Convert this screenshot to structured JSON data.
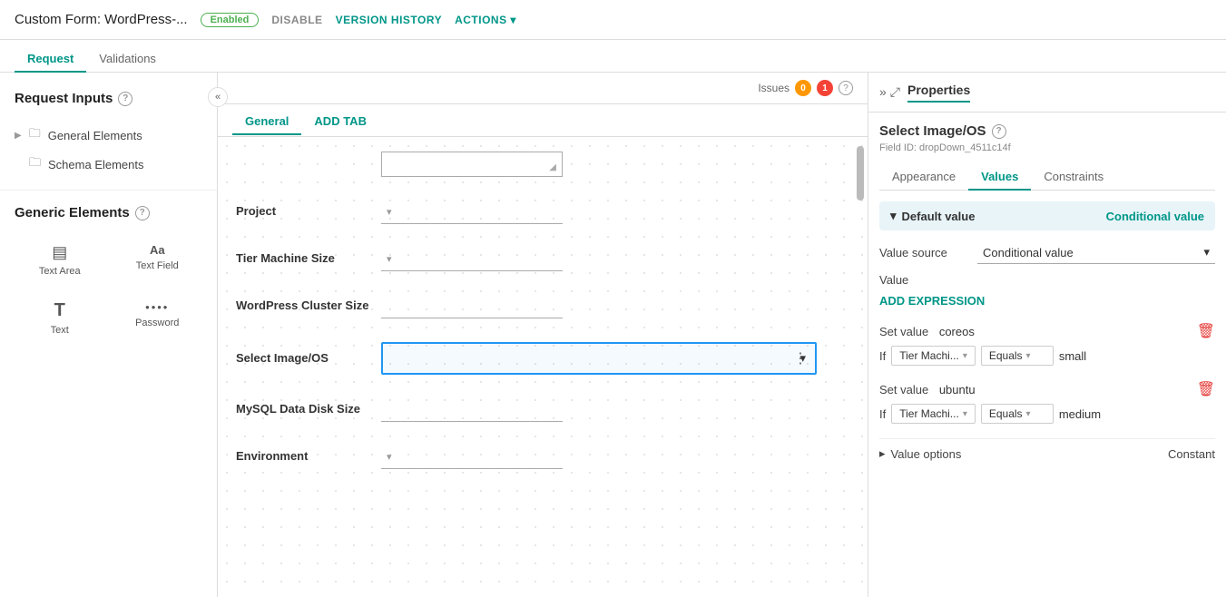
{
  "topbar": {
    "title": "Custom Form: WordPress-...",
    "status": "Enabled",
    "disable_btn": "DISABLE",
    "version_history_btn": "VERSION HISTORY",
    "actions_btn": "ACTIONS ▾"
  },
  "main_tabs": [
    {
      "label": "Request",
      "active": true
    },
    {
      "label": "Validations",
      "active": false
    }
  ],
  "left_sidebar": {
    "collapse_icon": "«",
    "request_inputs_title": "Request Inputs",
    "help_icon": "?",
    "groups": [
      {
        "label": "General Elements",
        "has_arrow": true
      },
      {
        "label": "Schema Elements",
        "has_arrow": false
      }
    ],
    "generic_elements_title": "Generic Elements",
    "generic_elements": [
      {
        "icon": "⬛",
        "label": "Text Area",
        "icon_char": "▤"
      },
      {
        "icon": "Aa",
        "label": "Text Field"
      },
      {
        "icon": "T",
        "label": "Text"
      },
      {
        "icon": "••••",
        "label": "Password"
      }
    ]
  },
  "center_panel": {
    "issues_label": "Issues",
    "badge_orange": "0",
    "badge_red": "1",
    "form_tabs": [
      {
        "label": "General",
        "active": true
      },
      {
        "label": "ADD TAB",
        "active": false,
        "is_add": true
      }
    ],
    "fields": [
      {
        "id": "text-input",
        "label": "",
        "type": "text-input"
      },
      {
        "id": "project",
        "label": "Project",
        "type": "dropdown"
      },
      {
        "id": "tier-machine-size",
        "label": "Tier Machine Size",
        "type": "dropdown"
      },
      {
        "id": "wordpress-cluster-size",
        "label": "WordPress Cluster Size",
        "type": "input"
      },
      {
        "id": "select-image-os",
        "label": "Select Image/OS",
        "type": "dropdown-selected"
      },
      {
        "id": "mysql-data-disk-size",
        "label": "MySQL Data Disk Size",
        "type": "input"
      },
      {
        "id": "environment",
        "label": "Environment",
        "type": "dropdown"
      }
    ]
  },
  "right_panel": {
    "expand_icons": [
      "»",
      "⤢"
    ],
    "title": "Properties",
    "field_title": "Select Image/OS",
    "field_id": "Field ID: dropDown_4511c14f",
    "prop_tabs": [
      {
        "label": "Appearance",
        "active": false
      },
      {
        "label": "Values",
        "active": true
      },
      {
        "label": "Constraints",
        "active": false
      }
    ],
    "default_value_label": "Default value",
    "default_value_arrow": "▾",
    "conditional_value_label": "Conditional value",
    "value_source_label": "Value source",
    "value_source_value": "Conditional value",
    "value_source_arrow": "▾",
    "value_label": "Value",
    "add_expression_btn": "ADD EXPRESSION",
    "set_value_blocks": [
      {
        "set_value_text": "Set value",
        "set_value_val": "coreos",
        "if_label": "If",
        "condition_field": "Tier Machi...",
        "condition_op": "Equals",
        "condition_val": "small"
      },
      {
        "set_value_text": "Set value",
        "set_value_val": "ubuntu",
        "if_label": "If",
        "condition_field": "Tier Machi...",
        "condition_op": "Equals",
        "condition_val": "medium"
      }
    ],
    "value_options_label": "Value options",
    "value_options_arrow": "▸",
    "constant_label": "Constant"
  }
}
